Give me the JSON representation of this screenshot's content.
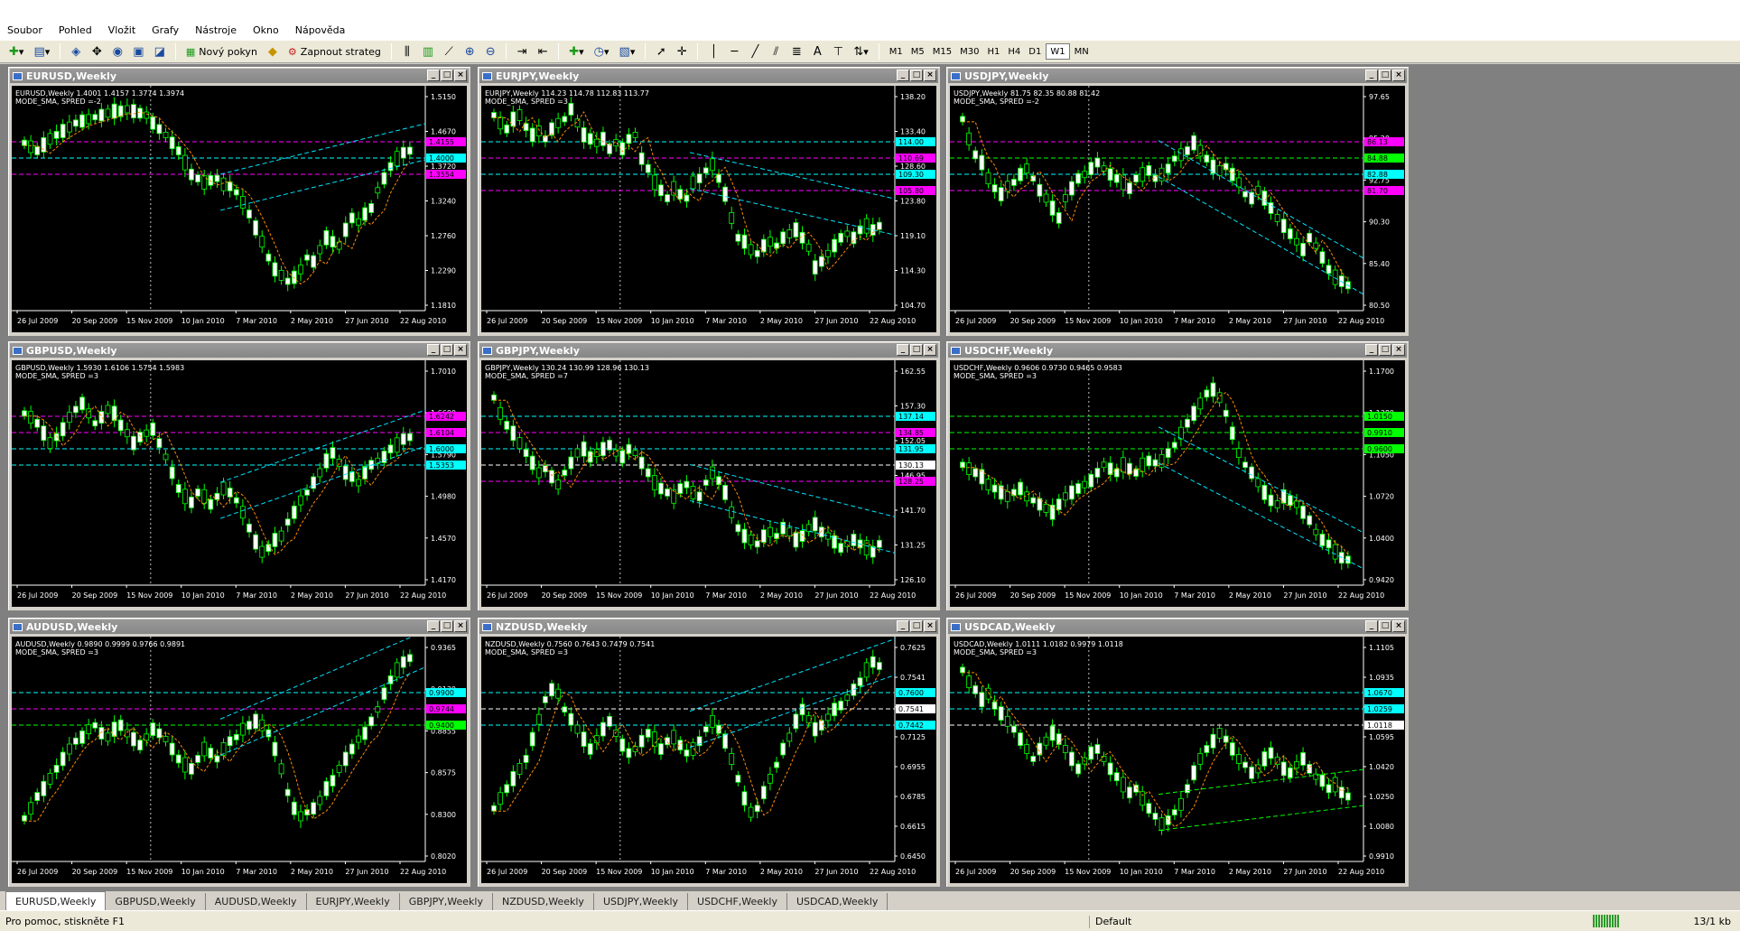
{
  "menu": [
    "Soubor",
    "Pohled",
    "Vložit",
    "Grafy",
    "Nástroje",
    "Okno",
    "Nápověda"
  ],
  "toolbar": {
    "new_order_label": "Nový pokyn",
    "strategy_label": "Zapnout strateg",
    "timeframes": [
      "M1",
      "M5",
      "M15",
      "M30",
      "H1",
      "H4",
      "D1",
      "W1",
      "MN"
    ],
    "active_timeframe": "W1"
  },
  "dates": [
    "26 Jul 2009",
    "20 Sep 2009",
    "15 Nov 2009",
    "10 Jan 2010",
    "7 Mar 2010",
    "2 May 2010",
    "27 Jun 2010",
    "22 Aug 2010"
  ],
  "charts": [
    {
      "title": "EURUSD,Weekly",
      "info": "EURUSD,Weekly  1.4001 1.4157 1.3774 1.3974",
      "mode": "MODE_SMA, SPRED =-2",
      "ticks": [
        "1.5150",
        "1.4670",
        "1.3720",
        "1.3240",
        "1.2760",
        "1.2290",
        "1.1810"
      ],
      "labels": [
        {
          "text": "1.4155",
          "color": "#ff00ff"
        },
        {
          "text": "1.4000",
          "color": "#00ffff"
        },
        {
          "text": "1.3554",
          "color": "#ff00ff"
        }
      ],
      "path": [
        0.22,
        0.24,
        0.26,
        0.23,
        0.2,
        0.18,
        0.16,
        0.14,
        0.12,
        0.11,
        0.1,
        0.09,
        0.08,
        0.07,
        0.06,
        0.06,
        0.05,
        0.06,
        0.07,
        0.08,
        0.12,
        0.15,
        0.18,
        0.22,
        0.26,
        0.32,
        0.38,
        0.4,
        0.42,
        0.41,
        0.4,
        0.43,
        0.44,
        0.47,
        0.52,
        0.58,
        0.65,
        0.72,
        0.8,
        0.86,
        0.89,
        0.92,
        0.9,
        0.86,
        0.8,
        0.82,
        0.76,
        0.7,
        0.72,
        0.74,
        0.66,
        0.6,
        0.62,
        0.58,
        0.55,
        0.46,
        0.4,
        0.34,
        0.3,
        0.27,
        0.26
      ]
    },
    {
      "title": "EURJPY,Weekly",
      "info": "EURJPY,Weekly  114.23 114.78 112.83 113.77",
      "mode": "MODE_SMA, SPRED =3",
      "ticks": [
        "138.20",
        "133.40",
        "128.60",
        "123.80",
        "119.10",
        "114.30",
        "104.70"
      ],
      "labels": [
        {
          "text": "114.00",
          "color": "#00ffff"
        },
        {
          "text": "110.69",
          "color": "#ff00ff"
        },
        {
          "text": "109.30",
          "color": "#00ffff"
        },
        {
          "text": "105.80",
          "color": "#ff00ff"
        }
      ],
      "path": [
        0.08,
        0.12,
        0.15,
        0.1,
        0.08,
        0.14,
        0.18,
        0.16,
        0.2,
        0.15,
        0.12,
        0.1,
        0.05,
        0.12,
        0.18,
        0.2,
        0.22,
        0.2,
        0.25,
        0.22,
        0.25,
        0.2,
        0.18,
        0.3,
        0.35,
        0.42,
        0.46,
        0.5,
        0.45,
        0.48,
        0.5,
        0.42,
        0.4,
        0.36,
        0.33,
        0.4,
        0.48,
        0.6,
        0.7,
        0.72,
        0.76,
        0.78,
        0.74,
        0.72,
        0.74,
        0.7,
        0.68,
        0.66,
        0.7,
        0.75,
        0.85,
        0.82,
        0.78,
        0.74,
        0.7,
        0.68,
        0.7,
        0.66,
        0.64,
        0.66,
        0.64
      ]
    },
    {
      "title": "USDJPY,Weekly",
      "info": "USDJPY,Weekly  81.75 82.35 80.88 81.42",
      "mode": "MODE_SMA, SPRED =-2",
      "ticks": [
        "97.65",
        "95.20",
        "92.75",
        "90.30",
        "85.40",
        "80.50"
      ],
      "labels": [
        {
          "text": "86.13",
          "color": "#ff00ff"
        },
        {
          "text": "84.88",
          "color": "#00ff00"
        },
        {
          "text": "82.88",
          "color": "#00ffff"
        },
        {
          "text": "81.70",
          "color": "#ff00ff"
        }
      ],
      "path": [
        0.1,
        0.2,
        0.28,
        0.32,
        0.4,
        0.45,
        0.48,
        0.44,
        0.42,
        0.38,
        0.35,
        0.4,
        0.46,
        0.5,
        0.55,
        0.6,
        0.5,
        0.45,
        0.4,
        0.38,
        0.35,
        0.32,
        0.35,
        0.38,
        0.4,
        0.42,
        0.45,
        0.4,
        0.38,
        0.36,
        0.4,
        0.38,
        0.35,
        0.3,
        0.28,
        0.26,
        0.22,
        0.26,
        0.3,
        0.34,
        0.36,
        0.34,
        0.38,
        0.42,
        0.48,
        0.5,
        0.46,
        0.5,
        0.55,
        0.6,
        0.64,
        0.68,
        0.72,
        0.76,
        0.7,
        0.74,
        0.8,
        0.86,
        0.9,
        0.92,
        0.94
      ]
    },
    {
      "title": "GBPUSD,Weekly",
      "info": "GBPUSD,Weekly  1.5930 1.6106 1.5754 1.5983",
      "mode": "MODE_SMA, SPRED =3",
      "ticks": [
        "1.7010",
        "1.6600",
        "1.5790",
        "1.4980",
        "1.4570",
        "1.4170"
      ],
      "labels": [
        {
          "text": "1.6242",
          "color": "#ff00ff"
        },
        {
          "text": "1.6104",
          "color": "#ff00ff"
        },
        {
          "text": "1.6000",
          "color": "#00ffff"
        },
        {
          "text": "1.5353",
          "color": "#00ffff"
        }
      ],
      "path": [
        0.2,
        0.22,
        0.25,
        0.3,
        0.35,
        0.32,
        0.28,
        0.22,
        0.18,
        0.15,
        0.2,
        0.25,
        0.22,
        0.18,
        0.2,
        0.26,
        0.3,
        0.35,
        0.32,
        0.3,
        0.28,
        0.35,
        0.42,
        0.5,
        0.58,
        0.62,
        0.65,
        0.6,
        0.62,
        0.66,
        0.62,
        0.58,
        0.6,
        0.64,
        0.7,
        0.78,
        0.85,
        0.9,
        0.88,
        0.84,
        0.82,
        0.75,
        0.7,
        0.64,
        0.6,
        0.55,
        0.5,
        0.44,
        0.4,
        0.45,
        0.5,
        0.52,
        0.55,
        0.5,
        0.46,
        0.44,
        0.42,
        0.38,
        0.36,
        0.33,
        0.32
      ]
    },
    {
      "title": "GBPJPY,Weekly",
      "info": "GBPJPY,Weekly  130.24 130.99 128.96 130.13",
      "mode": "MODE_SMA, SPRED =7",
      "ticks": [
        "162.55",
        "157.30",
        "152.05",
        "146.95",
        "141.70",
        "131.25",
        "126.10"
      ],
      "labels": [
        {
          "text": "137.14",
          "color": "#00ffff"
        },
        {
          "text": "134.85",
          "color": "#ff00ff"
        },
        {
          "text": "131.95",
          "color": "#00ffff"
        },
        {
          "text": "130.13",
          "color": "#ffffff"
        },
        {
          "text": "128.25",
          "color": "#ff00ff"
        }
      ],
      "path": [
        0.12,
        0.2,
        0.26,
        0.3,
        0.35,
        0.4,
        0.45,
        0.5,
        0.48,
        0.52,
        0.56,
        0.5,
        0.45,
        0.4,
        0.38,
        0.42,
        0.4,
        0.38,
        0.36,
        0.4,
        0.42,
        0.38,
        0.4,
        0.45,
        0.5,
        0.55,
        0.58,
        0.6,
        0.62,
        0.58,
        0.56,
        0.6,
        0.62,
        0.55,
        0.5,
        0.54,
        0.6,
        0.7,
        0.78,
        0.82,
        0.84,
        0.86,
        0.82,
        0.8,
        0.82,
        0.78,
        0.8,
        0.84,
        0.82,
        0.78,
        0.76,
        0.8,
        0.82,
        0.85,
        0.88,
        0.86,
        0.84,
        0.86,
        0.88,
        0.9,
        0.86
      ]
    },
    {
      "title": "USDCHF,Weekly",
      "info": "USDCHF,Weekly  0.9606 0.9730 0.9465 0.9583",
      "mode": "MODE_SMA, SPRED =3",
      "ticks": [
        "1.1700",
        "1.1380",
        "1.1050",
        "1.0720",
        "1.0400",
        "0.9420"
      ],
      "labels": [
        {
          "text": "1.0150",
          "color": "#00ff00"
        },
        {
          "text": "0.9910",
          "color": "#00ff00"
        },
        {
          "text": "0.9600",
          "color": "#00ff00"
        }
      ],
      "path": [
        0.46,
        0.48,
        0.5,
        0.52,
        0.56,
        0.58,
        0.6,
        0.62,
        0.6,
        0.58,
        0.62,
        0.64,
        0.66,
        0.68,
        0.7,
        0.66,
        0.62,
        0.6,
        0.58,
        0.56,
        0.54,
        0.5,
        0.46,
        0.48,
        0.5,
        0.46,
        0.48,
        0.5,
        0.46,
        0.44,
        0.45,
        0.44,
        0.4,
        0.36,
        0.3,
        0.25,
        0.2,
        0.15,
        0.1,
        0.08,
        0.12,
        0.2,
        0.3,
        0.4,
        0.46,
        0.5,
        0.55,
        0.6,
        0.64,
        0.66,
        0.62,
        0.64,
        0.66,
        0.7,
        0.74,
        0.8,
        0.84,
        0.86,
        0.9,
        0.93,
        0.94
      ]
    },
    {
      "title": "AUDUSD,Weekly",
      "info": "AUDUSD,Weekly  0.9890 0.9999 0.9766 0.9891",
      "mode": "MODE_SMA, SPRED =3",
      "ticks": [
        "0.9365",
        "0.9130",
        "0.8855",
        "0.8575",
        "0.8300",
        "0.8020"
      ],
      "labels": [
        {
          "text": "0.9900",
          "color": "#00ffff"
        },
        {
          "text": "0.9744",
          "color": "#ff00ff"
        },
        {
          "text": "0.9400",
          "color": "#00ff00"
        }
      ],
      "path": [
        0.85,
        0.8,
        0.74,
        0.7,
        0.65,
        0.6,
        0.55,
        0.5,
        0.46,
        0.44,
        0.4,
        0.38,
        0.42,
        0.44,
        0.4,
        0.38,
        0.42,
        0.45,
        0.48,
        0.44,
        0.4,
        0.42,
        0.45,
        0.5,
        0.55,
        0.58,
        0.6,
        0.55,
        0.5,
        0.52,
        0.55,
        0.5,
        0.46,
        0.44,
        0.4,
        0.38,
        0.36,
        0.38,
        0.42,
        0.5,
        0.6,
        0.72,
        0.8,
        0.84,
        0.82,
        0.8,
        0.76,
        0.7,
        0.66,
        0.6,
        0.55,
        0.5,
        0.45,
        0.42,
        0.36,
        0.3,
        0.22,
        0.15,
        0.1,
        0.06,
        0.04
      ]
    },
    {
      "title": "NZDUSD,Weekly",
      "info": "NZDUSD,Weekly  0.7560 0.7643 0.7479 0.7541",
      "mode": "MODE_SMA, SPRED =3",
      "ticks": [
        "0.7625",
        "0.7541",
        "0.7295",
        "0.7125",
        "0.6955",
        "0.6785",
        "0.6615",
        "0.6450"
      ],
      "labels": [
        {
          "text": "0.7600",
          "color": "#00ffff"
        },
        {
          "text": "0.7541",
          "color": "#ffffff"
        },
        {
          "text": "0.7442",
          "color": "#00ffff"
        }
      ],
      "path": [
        0.8,
        0.75,
        0.7,
        0.65,
        0.6,
        0.55,
        0.45,
        0.35,
        0.25,
        0.2,
        0.22,
        0.3,
        0.35,
        0.4,
        0.45,
        0.5,
        0.45,
        0.4,
        0.36,
        0.42,
        0.48,
        0.52,
        0.5,
        0.46,
        0.42,
        0.45,
        0.5,
        0.46,
        0.44,
        0.48,
        0.52,
        0.5,
        0.46,
        0.4,
        0.36,
        0.4,
        0.46,
        0.55,
        0.65,
        0.75,
        0.82,
        0.8,
        0.72,
        0.65,
        0.58,
        0.5,
        0.44,
        0.36,
        0.3,
        0.35,
        0.4,
        0.38,
        0.34,
        0.3,
        0.28,
        0.24,
        0.2,
        0.16,
        0.1,
        0.06,
        0.08
      ]
    },
    {
      "title": "USDCAD,Weekly",
      "info": "USDCAD,Weekly  1.0111 1.0182 0.9979 1.0118",
      "mode": "MODE_SMA, SPRED =3",
      "ticks": [
        "1.1105",
        "1.0935",
        "1.0765",
        "1.0595",
        "1.0420",
        "1.0250",
        "1.0080",
        "0.9910"
      ],
      "labels": [
        {
          "text": "1.0670",
          "color": "#00ffff"
        },
        {
          "text": "1.0259",
          "color": "#00ffff"
        },
        {
          "text": "1.0118",
          "color": "#ffffff"
        }
      ],
      "path": [
        0.1,
        0.16,
        0.2,
        0.25,
        0.22,
        0.28,
        0.32,
        0.36,
        0.4,
        0.45,
        0.5,
        0.55,
        0.5,
        0.46,
        0.42,
        0.45,
        0.5,
        0.55,
        0.6,
        0.56,
        0.52,
        0.5,
        0.55,
        0.6,
        0.64,
        0.68,
        0.72,
        0.7,
        0.75,
        0.8,
        0.84,
        0.88,
        0.86,
        0.82,
        0.78,
        0.7,
        0.62,
        0.55,
        0.5,
        0.46,
        0.42,
        0.45,
        0.5,
        0.55,
        0.58,
        0.62,
        0.6,
        0.55,
        0.52,
        0.56,
        0.6,
        0.62,
        0.58,
        0.55,
        0.6,
        0.64,
        0.66,
        0.7,
        0.68,
        0.72,
        0.74
      ]
    }
  ],
  "tabs": [
    "EURUSD,Weekly",
    "GBPUSD,Weekly",
    "AUDUSD,Weekly",
    "EURJPY,Weekly",
    "GBPJPY,Weekly",
    "NZDUSD,Weekly",
    "USDJPY,Weekly",
    "USDCHF,Weekly",
    "USDCAD,Weekly"
  ],
  "status": {
    "help": "Pro pomoc, stiskněte F1",
    "profile": "Default",
    "traffic": "13/1 kb"
  }
}
